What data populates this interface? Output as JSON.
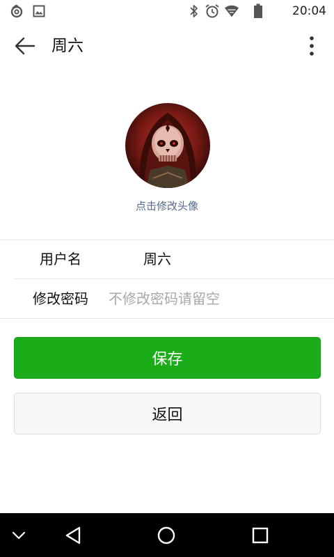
{
  "status_bar": {
    "time": "20:04",
    "left_icons": [
      "sync-app-icon",
      "image-notification-icon"
    ],
    "right_icons": [
      "bluetooth-icon",
      "alarm-icon",
      "wifi-icon",
      "battery-icon"
    ]
  },
  "app_bar": {
    "title": "周六",
    "back_icon": "arrow-left-icon",
    "menu_icon": "more-vert-icon"
  },
  "profile": {
    "avatar_hint": "点击修改头像"
  },
  "form": {
    "username_label": "用户名",
    "username_value": "周六",
    "password_label": "修改密码",
    "password_placeholder": "不修改密码请留空",
    "password_value": ""
  },
  "buttons": {
    "save_label": "保存",
    "back_label": "返回"
  },
  "colors": {
    "primary_green": "#1aad19",
    "link_blue": "#54698f",
    "placeholder_gray": "#a8a8a8"
  },
  "nav_bar": {
    "icons": [
      "chevron-down-icon",
      "nav-back-icon",
      "nav-home-icon",
      "nav-recents-icon"
    ]
  }
}
